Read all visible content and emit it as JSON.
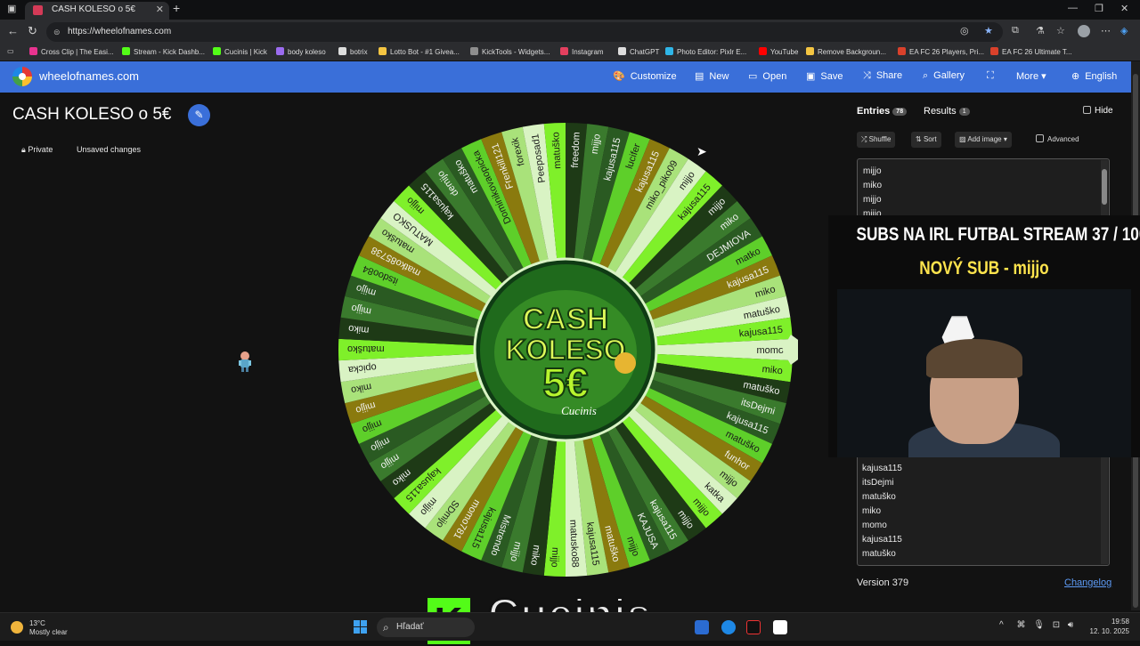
{
  "browser": {
    "tab_title": "CASH KOLESO o 5€",
    "url": "https://wheelofnames.com",
    "bookmarks": [
      "Cross Clip | The Easi...",
      "Stream - Kick Dashb...",
      "Cucinis | Kick",
      "body koleso",
      "botrix",
      "Lotto Bot - #1 Givea...",
      "KickTools - Widgets...",
      "Instagram",
      "ChatGPT",
      "Photo Editor: Pixlr E...",
      "YouTube",
      "Remove Backgroun...",
      "EA FC 26 Players, Pri...",
      "EA FC 26 Ultimate T..."
    ],
    "bookmark_colors": [
      "#e8338f",
      "#53fc18",
      "#53fc18",
      "#9c6cf0",
      "#dddddd",
      "#f4c542",
      "#8e8e8e",
      "#e4405f",
      "#dddddd",
      "#2fb6e8",
      "#ff0000",
      "#f4c542",
      "#d9412b",
      "#d9412b"
    ]
  },
  "app": {
    "site_name": "wheelofnames.com",
    "nav": [
      {
        "icon": "palette-icon",
        "glyph": "🎨",
        "label": "Customize"
      },
      {
        "icon": "new-file-icon",
        "glyph": "▤",
        "label": "New"
      },
      {
        "icon": "folder-icon",
        "glyph": "▭",
        "label": "Open"
      },
      {
        "icon": "save-icon",
        "glyph": "▣",
        "label": "Save"
      },
      {
        "icon": "share-icon",
        "glyph": "⤨",
        "label": "Share"
      },
      {
        "icon": "search-icon",
        "glyph": "⌕",
        "label": "Gallery"
      },
      {
        "icon": "fullscreen-icon",
        "glyph": "⛶",
        "label": ""
      },
      {
        "icon": "chevron-down-icon",
        "glyph": "",
        "label": "More ▾"
      },
      {
        "icon": "globe-icon",
        "glyph": "⊕",
        "label": "English"
      }
    ],
    "wheel_title": "CASH KOLESO o 5€",
    "private_label": "Private",
    "unsaved_label": "Unsaved changes"
  },
  "wheel": {
    "center_line1": "CASH",
    "center_line2": "KOLESO",
    "center_line3": "5€",
    "center_sub": "Cucinis",
    "segments": [
      "momo",
      "miko",
      "matuško",
      "itsDejmi",
      "kajusa115",
      "matuško",
      "funhor",
      "mijjo",
      "katka",
      "mijjo",
      "mijjo",
      "kajusa115",
      "KAJUSA",
      "mijjo",
      "matuško",
      "kajusa115",
      "matusko88",
      "mijjo",
      "miko",
      "mijjo",
      "Mistrendo",
      "kajusa115",
      "momo781",
      "SDmijo",
      "mijjo",
      "kajusa115",
      "miko",
      "mijjo",
      "mijjo",
      "mijjo",
      "mijjo",
      "miko",
      "opicka",
      "matuško",
      "miko",
      "mijjo",
      "mijjo",
      "itsdoo84",
      "matko85738",
      "matuško",
      "MATUSKO",
      "mijjo",
      "kajusa115",
      "demijo",
      "matuško",
      "Dominikovaopicka",
      "Frenkill121",
      "forexik",
      "Peeposad1",
      "matuško",
      "freedom",
      "mijjo",
      "kajusa115",
      "lucifer",
      "kajusa115",
      "miko_piko09",
      "mijjo",
      "kajusa115",
      "mijjo",
      "miko",
      "DEJMIOVA",
      "matko",
      "kajusa115",
      "miko",
      "matuško",
      "kajusa115"
    ],
    "colors": [
      "#d9f3c4",
      "#3a7a2d",
      "#8a7a0e",
      "#7ff02a",
      "#2a5a22",
      "#a9e27a",
      "#1e3a16",
      "#5ecf2a"
    ]
  },
  "panel": {
    "entries_label": "Entries",
    "entries_count": "78",
    "results_label": "Results",
    "results_count": "1",
    "hide_label": "Hide",
    "shuffle_label": "Shuffle",
    "sort_label": "Sort",
    "add_image_label": "Add image",
    "advanced_label": "Advanced",
    "entries_top": [
      "mijjo",
      "miko",
      "mijjo",
      "mijjo"
    ],
    "entries_bottom": [
      "kajusa115",
      "itsDejmi",
      "matuško",
      "miko",
      "momo",
      "kajusa115",
      "matuško"
    ],
    "version": "Version 379",
    "changelog": "Changelog"
  },
  "overlay": {
    "title": "SUBS NA IRL FUTBAL STREAM  37 / 100",
    "new_sub": "NOVÝ SUB - mijjo"
  },
  "streamer_name": "Cucinis",
  "taskbar": {
    "temp": "13°C",
    "condition": "Mostly clear",
    "search_placeholder": "Hľadať",
    "time": "19:58",
    "date": "12. 10. 2025"
  }
}
